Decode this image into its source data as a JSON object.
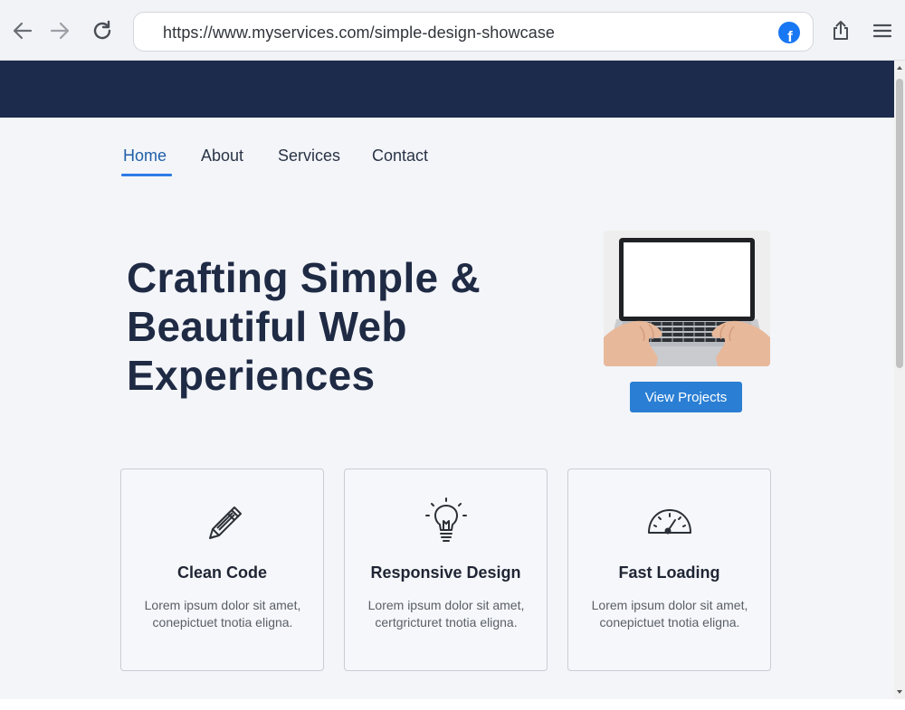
{
  "browser": {
    "url": "https://www.myservices.com/simple-design-showcase",
    "badge_letter": "f"
  },
  "nav": {
    "items": [
      {
        "label": "Home",
        "active": true
      },
      {
        "label": "About",
        "active": false
      },
      {
        "label": "Services",
        "active": false
      },
      {
        "label": "Contact",
        "active": false
      }
    ]
  },
  "hero": {
    "title_lines": [
      "Crafting Simple &",
      "Beautiful Web",
      "Experiences"
    ],
    "cta_label": "View Projects"
  },
  "features": [
    {
      "icon": "pencil-icon",
      "title": "Clean Code",
      "text": "Lorem ipsum dolor sit amet, conepictuet tnotia eligna."
    },
    {
      "icon": "lightbulb-icon",
      "title": "Responsive Design",
      "text": "Lorem ipsum dolor sit amet, certgricturet tnotia eligna."
    },
    {
      "icon": "speedometer-icon",
      "title": "Fast Loading",
      "text": "Lorem ipsum dolor sit amet, conepictuet tnotia eligna."
    }
  ],
  "colors": {
    "banner": "#1c2b4b",
    "accent": "#2a7fd4",
    "heading": "#1f2a44",
    "page_bg": "#f3f5f9"
  }
}
